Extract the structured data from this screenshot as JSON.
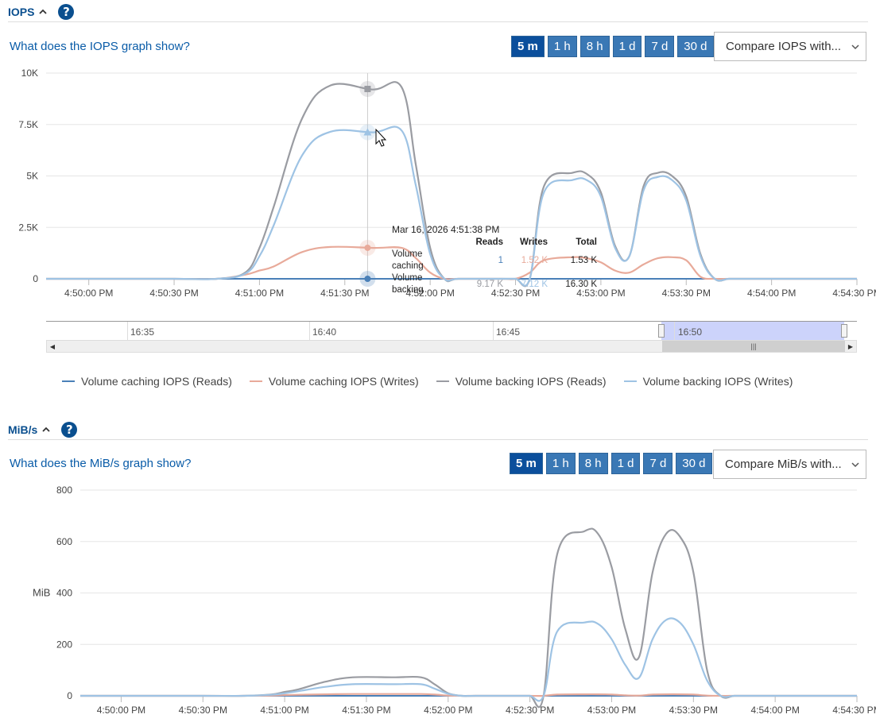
{
  "iops": {
    "title": "IOPS",
    "help": "?",
    "what_link": "What does the IOPS graph show?",
    "ranges": [
      "5 m",
      "1 h",
      "8 h",
      "1 d",
      "7 d",
      "30 d"
    ],
    "active_range": "5 m",
    "compare": "Compare IOPS with..."
  },
  "mibs": {
    "title": "MiB/s",
    "help": "?",
    "what_link": "What does the MiB/s graph show?",
    "ranges": [
      "5 m",
      "1 h",
      "8 h",
      "1 d",
      "7 d",
      "30 d"
    ],
    "active_range": "5 m",
    "compare": "Compare MiB/s with..."
  },
  "colors": {
    "caching_reads": "#4a80b8",
    "caching_writes": "#e8aa9a",
    "backing_reads": "#9a9ca2",
    "backing_writes": "#9ec3e4"
  },
  "legend": [
    {
      "label": "Volume caching IOPS (Reads)",
      "color": "#4a80b8"
    },
    {
      "label": "Volume caching IOPS (Writes)",
      "color": "#e8aa9a"
    },
    {
      "label": "Volume backing IOPS (Reads)",
      "color": "#9a9ca2"
    },
    {
      "label": "Volume backing IOPS (Writes)",
      "color": "#9ec3e4"
    }
  ],
  "tooltip": {
    "title": "Mar 16, 2026 4:51:38 PM",
    "headers": [
      "Reads",
      "Writes",
      "Total"
    ],
    "rows": [
      {
        "label": "Volume caching",
        "reads": "1",
        "writes": "1.52 K",
        "total": "1.53 K"
      },
      {
        "label": "Volume backing",
        "reads": "9.17 K",
        "writes": "7.12 K",
        "total": "16.30 K"
      }
    ]
  },
  "navigator": {
    "labels": [
      "16:35",
      "16:40",
      "16:45",
      "16:50"
    ]
  },
  "chart_data": [
    {
      "type": "line",
      "title": "",
      "xlabel": "",
      "ylabel": "",
      "ylim": [
        0,
        10000
      ],
      "y_ticks": [
        "0",
        "2.5K",
        "5K",
        "7.5K",
        "10K"
      ],
      "x_tick_labels": [
        "4:50:00 PM",
        "4:50:30 PM",
        "4:51:00 PM",
        "4:51:30 PM",
        "4:52:00 PM",
        "4:52:30 PM",
        "4:53:00 PM",
        "4:53:30 PM",
        "4:54:00 PM",
        "4:54:30 PM"
      ],
      "grid": true,
      "legend_position": "bottom",
      "x": [
        -15,
        0,
        30,
        45,
        55,
        60,
        65,
        75,
        85,
        100,
        110,
        115,
        120,
        125,
        130,
        145,
        150,
        155,
        160,
        170,
        175,
        180,
        185,
        190,
        195,
        200,
        205,
        210,
        215,
        220,
        225,
        230,
        240,
        255,
        270
      ],
      "series": [
        {
          "name": "Volume caching IOPS (Reads)",
          "color": "#4a80b8",
          "values": [
            0,
            0,
            0,
            0,
            0,
            0,
            0,
            0,
            0,
            0,
            0,
            0,
            0,
            0,
            0,
            0,
            0,
            0,
            0,
            0,
            0,
            0,
            0,
            0,
            0,
            0,
            0,
            0,
            0,
            0,
            0,
            0,
            0,
            0,
            0
          ]
        },
        {
          "name": "Volume caching IOPS (Writes)",
          "color": "#e8aa9a",
          "values": [
            0,
            0,
            0,
            0,
            200,
            400,
            600,
            1300,
            1550,
            1500,
            1500,
            1000,
            300,
            0,
            0,
            0,
            0,
            300,
            900,
            1050,
            1000,
            800,
            400,
            300,
            700,
            1000,
            1050,
            900,
            100,
            0,
            0,
            0,
            0,
            0,
            0
          ]
        },
        {
          "name": "Volume backing IOPS (Reads)",
          "color": "#9a9ca2",
          "values": [
            0,
            0,
            0,
            0,
            300,
            1500,
            3500,
            7800,
            9400,
            9200,
            9300,
            5500,
            1500,
            0,
            0,
            0,
            0,
            0,
            4500,
            5150,
            5100,
            4200,
            1600,
            1100,
            4500,
            5150,
            5000,
            4000,
            1200,
            0,
            0,
            0,
            0,
            0,
            0
          ]
        },
        {
          "name": "Volume backing IOPS (Writes)",
          "color": "#9ec3e4",
          "values": [
            0,
            0,
            0,
            0,
            250,
            1100,
            2600,
            6000,
            7150,
            7120,
            7200,
            4500,
            1200,
            0,
            0,
            0,
            0,
            0,
            4200,
            4800,
            4800,
            4000,
            1500,
            1100,
            4300,
            4950,
            4800,
            3800,
            1100,
            0,
            0,
            0,
            0,
            0,
            0
          ]
        }
      ],
      "crosshair_x": 98
    },
    {
      "type": "line",
      "title": "",
      "xlabel": "",
      "ylabel": "MiB",
      "ylim": [
        0,
        800
      ],
      "y_ticks": [
        "0",
        "200",
        "400",
        "600",
        "800"
      ],
      "x_tick_labels": [
        "4:50:00 PM",
        "4:50:30 PM",
        "4:51:00 PM",
        "4:51:30 PM",
        "4:52:00 PM",
        "4:52:30 PM",
        "4:53:00 PM",
        "4:53:30 PM",
        "4:54:00 PM",
        "4:54:30 PM"
      ],
      "grid": true,
      "x": [
        -15,
        0,
        30,
        45,
        55,
        60,
        65,
        75,
        85,
        100,
        110,
        115,
        120,
        125,
        130,
        145,
        150,
        155,
        160,
        170,
        175,
        180,
        185,
        190,
        195,
        200,
        205,
        210,
        215,
        220,
        225,
        230,
        240,
        255,
        270
      ],
      "series": [
        {
          "name": "Volume caching IOPS (Reads)",
          "color": "#4a80b8",
          "values": [
            0,
            0,
            0,
            0,
            0,
            0,
            0,
            0,
            0,
            0,
            0,
            0,
            0,
            0,
            0,
            0,
            0,
            0,
            0,
            0,
            0,
            0,
            0,
            0,
            0,
            0,
            0,
            0,
            0,
            0,
            0,
            0,
            0,
            0,
            0
          ]
        },
        {
          "name": "Volume caching IOPS (Writes)",
          "color": "#e8aa9a",
          "values": [
            0,
            0,
            0,
            0,
            1,
            3,
            4,
            6,
            7,
            7,
            7,
            5,
            1,
            0,
            0,
            0,
            0,
            0,
            5,
            6,
            6,
            5,
            2,
            1,
            5,
            6,
            6,
            5,
            1,
            0,
            0,
            0,
            0,
            0,
            0
          ]
        },
        {
          "name": "Volume backing IOPS (Reads)",
          "color": "#9a9ca2",
          "values": [
            0,
            0,
            0,
            0,
            5,
            15,
            25,
            55,
            72,
            72,
            72,
            45,
            10,
            0,
            0,
            0,
            0,
            0,
            550,
            640,
            630,
            500,
            260,
            150,
            480,
            630,
            620,
            480,
            100,
            0,
            0,
            0,
            0,
            0,
            0
          ]
        },
        {
          "name": "Volume backing IOPS (Writes)",
          "color": "#9ec3e4",
          "values": [
            0,
            0,
            0,
            0,
            4,
            10,
            18,
            35,
            45,
            45,
            45,
            28,
            8,
            0,
            0,
            0,
            0,
            0,
            250,
            285,
            280,
            220,
            120,
            70,
            220,
            295,
            285,
            200,
            60,
            0,
            0,
            0,
            0,
            0,
            0
          ]
        }
      ]
    }
  ]
}
